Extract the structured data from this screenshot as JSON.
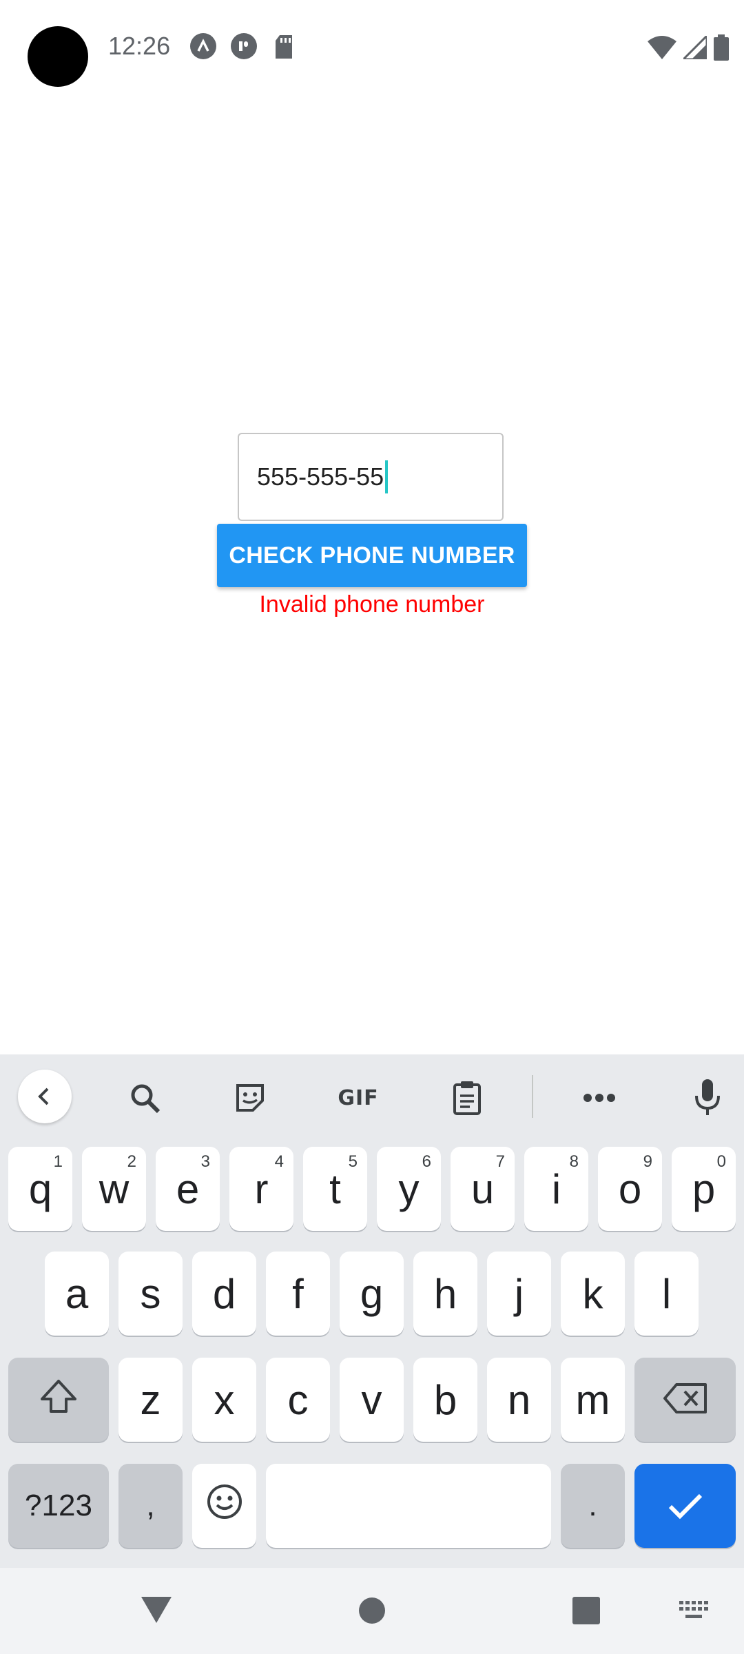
{
  "status_bar": {
    "time": "12:26",
    "left_icons": [
      "app-a-icon",
      "app-b-icon",
      "sd-card-icon"
    ],
    "right_icons": [
      "wifi-icon",
      "signal-icon",
      "battery-icon"
    ]
  },
  "form": {
    "phone_value": "555-555-55",
    "check_button_label": "CHECK PHONE NUMBER",
    "error_message": "Invalid phone number",
    "colors": {
      "button": "#2196f3",
      "error": "#ff0000"
    }
  },
  "keyboard": {
    "toolbar": {
      "icons": [
        "back-icon",
        "search-icon",
        "sticker-icon",
        "gif-icon",
        "clipboard-icon",
        "more-icon",
        "mic-icon"
      ],
      "gif_label": "GIF"
    },
    "row1": [
      {
        "label": "q",
        "hint": "1"
      },
      {
        "label": "w",
        "hint": "2"
      },
      {
        "label": "e",
        "hint": "3"
      },
      {
        "label": "r",
        "hint": "4"
      },
      {
        "label": "t",
        "hint": "5"
      },
      {
        "label": "y",
        "hint": "6"
      },
      {
        "label": "u",
        "hint": "7"
      },
      {
        "label": "i",
        "hint": "8"
      },
      {
        "label": "o",
        "hint": "9"
      },
      {
        "label": "p",
        "hint": "0"
      }
    ],
    "row2": [
      "a",
      "s",
      "d",
      "f",
      "g",
      "h",
      "j",
      "k",
      "l"
    ],
    "row3": [
      "z",
      "x",
      "c",
      "v",
      "b",
      "n",
      "m"
    ],
    "row4": {
      "symbols_label": "?123",
      "comma_label": ",",
      "period_label": "."
    },
    "colors": {
      "background": "#e8eaed",
      "enter": "#1a73e8"
    }
  },
  "nav_bar": {
    "icons": [
      "back-triangle-icon",
      "home-circle-icon",
      "recents-square-icon",
      "keyboard-switch-icon"
    ]
  }
}
